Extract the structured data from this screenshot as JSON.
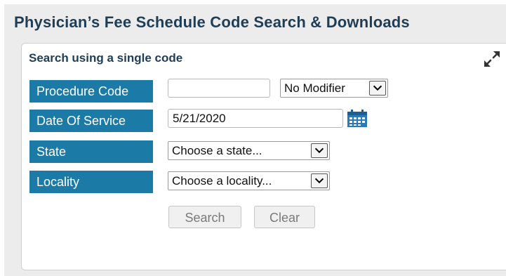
{
  "page": {
    "title": "Physician’s Fee Schedule Code Search & Downloads"
  },
  "panel": {
    "title": "Search using a single code",
    "expand_icon": "expand-arrows-icon"
  },
  "form": {
    "procedure_code": {
      "label": "Procedure Code",
      "value": "",
      "modifier_selected": "No Modifier"
    },
    "date_of_service": {
      "label": "Date Of Service",
      "value": "5/21/2020",
      "calendar_icon": "calendar-icon"
    },
    "state": {
      "label": "State",
      "selected": "Choose a state..."
    },
    "locality": {
      "label": "Locality",
      "selected": "Choose a locality..."
    }
  },
  "buttons": {
    "search": "Search",
    "clear": "Clear"
  },
  "colors": {
    "label_bg": "#1b7aa6",
    "title_text": "#1f3d55",
    "calendar_icon": "#2a7ab5"
  }
}
